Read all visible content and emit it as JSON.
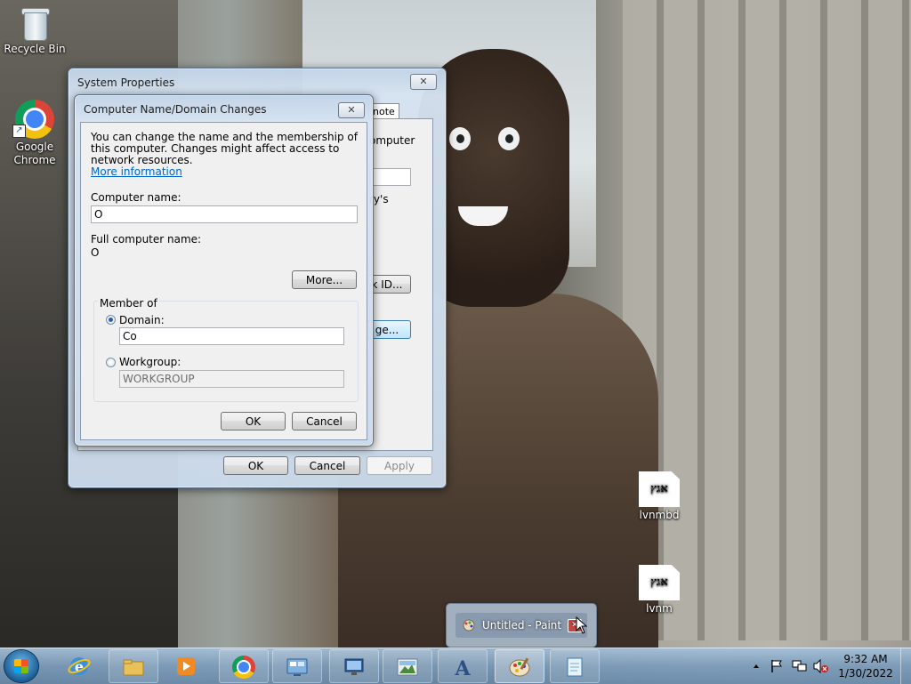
{
  "desktop": {
    "icons": [
      {
        "label": "Recycle Bin"
      },
      {
        "label": "Google Chrome"
      },
      {
        "label": "lvnmbd",
        "glyph_text": "אגץ"
      },
      {
        "label": "lvnm",
        "glyph_text": "אגץ"
      }
    ]
  },
  "system_properties": {
    "title": "System Properties",
    "close_symbol": "✕",
    "visible_tab": "note",
    "partial_texts": [
      "omputer",
      "ry's",
      "k ID...",
      "ge..."
    ],
    "buttons": {
      "ok": "OK",
      "cancel": "Cancel",
      "apply": "Apply"
    }
  },
  "name_dialog": {
    "title": "Computer Name/Domain Changes",
    "close_symbol": "✕",
    "intro": "You can change the name and the membership of this computer. Changes might affect access to network resources.",
    "more_info_link": "More information",
    "computer_name_label": "Computer name:",
    "computer_name_value": "O",
    "full_name_label": "Full computer name:",
    "full_name_value": "O",
    "more_button": "More...",
    "member_of_label": "Member of",
    "domain_label": "Domain:",
    "domain_value": "Co",
    "workgroup_label": "Workgroup:",
    "workgroup_value": "WORKGROUP",
    "selected_membership": "domain",
    "ok_button": "OK",
    "cancel_button": "Cancel"
  },
  "thumbnail_popup": {
    "label": "Untitled - Paint",
    "close_symbol": "✕"
  },
  "taskbar": {
    "items": [
      "windows-explorer",
      "windows-media-player",
      "google-chrome",
      "control-panel",
      "remote-desktop",
      "photo-viewer",
      "font-tool",
      "paint",
      "notepad"
    ],
    "clock_time": "9:32 AM",
    "clock_date": "1/30/2022",
    "tray_icons": [
      "show-hidden-icons",
      "action-center-flag",
      "network",
      "volume-muted"
    ]
  },
  "colors": {
    "link": "#0066cc",
    "taskbar": "#7a9bba",
    "dialog_face": "#f0f0f0",
    "focus_button": "#bee6fd"
  }
}
